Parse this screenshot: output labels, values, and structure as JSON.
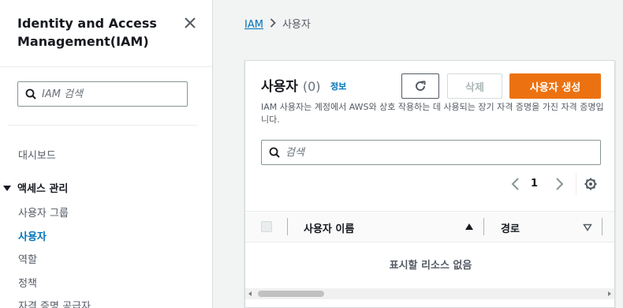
{
  "sidebar": {
    "title": "Identity and Access Management(IAM)",
    "search_placeholder": "IAM 검색",
    "dashboard": "대시보드",
    "section": "액세스 관리",
    "items": [
      "사용자 그룹",
      "사용자",
      "역할",
      "정책",
      "자격 증명 공급자"
    ],
    "active_item": "사용자"
  },
  "breadcrumb": {
    "root": "IAM",
    "current": "사용자"
  },
  "panel": {
    "title": "사용자",
    "count": "(0)",
    "info": "정보",
    "delete_label": "삭제",
    "create_label": "사용자 생성",
    "description": "IAM 사용자는 계정에서 AWS와 상호 작용하는 데 사용되는 장기 자격 증명을 가진 자격 증명입니다.",
    "search_placeholder": "검색",
    "page": "1",
    "columns": [
      "사용자 이름",
      "경로"
    ],
    "empty_text": "표시할 리소스 없음"
  },
  "colors": {
    "accent": "#0073bb",
    "primary_button": "#ec7211"
  }
}
